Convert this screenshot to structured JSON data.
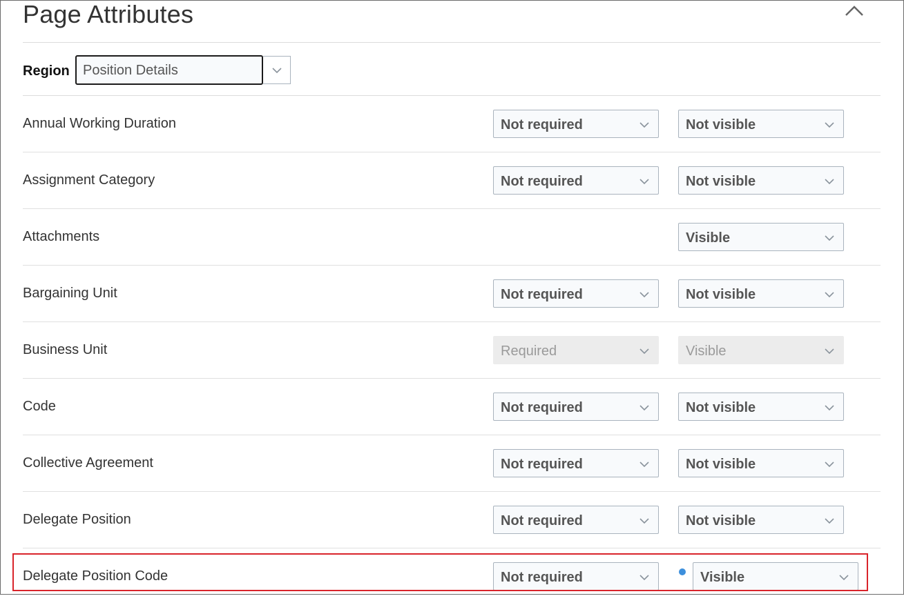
{
  "header": {
    "title": "Page Attributes"
  },
  "region": {
    "label": "Region",
    "value": "Position Details"
  },
  "rows": [
    {
      "label": "Annual Working Duration",
      "required": "Not required",
      "visible": "Not visible"
    },
    {
      "label": "Assignment Category",
      "required": "Not required",
      "visible": "Not visible"
    },
    {
      "label": "Attachments",
      "required": "",
      "visible": "Visible"
    },
    {
      "label": "Bargaining Unit",
      "required": "Not required",
      "visible": "Not visible"
    },
    {
      "label": "Business Unit",
      "required": "Required",
      "visible": "Visible"
    },
    {
      "label": "Code",
      "required": "Not required",
      "visible": "Not visible"
    },
    {
      "label": "Collective Agreement",
      "required": "Not required",
      "visible": "Not visible"
    },
    {
      "label": "Delegate Position",
      "required": "Not required",
      "visible": "Not visible"
    },
    {
      "label": "Delegate Position Code",
      "required": "Not required",
      "visible": "Visible"
    }
  ],
  "colors": {
    "highlight": "#d9232a",
    "changed_indicator": "#3d8fdc"
  },
  "icons": {
    "collapse": "chevron-up-icon",
    "dropdown": "chevron-down-icon",
    "changed": "modified-dot-icon"
  }
}
